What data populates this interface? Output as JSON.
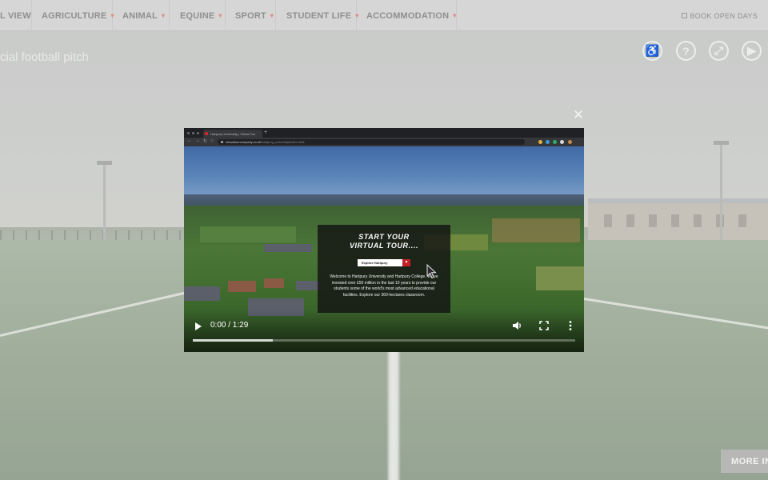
{
  "nav": {
    "items": [
      {
        "label": "L VIEW",
        "caret": ""
      },
      {
        "label": "AGRICULTURE",
        "caret": "▾"
      },
      {
        "label": "ANIMAL",
        "caret": "▾"
      },
      {
        "label": "EQUINE",
        "caret": "▾"
      },
      {
        "label": "SPORT",
        "caret": "▾"
      },
      {
        "label": "STUDENT LIFE",
        "caret": "▾"
      },
      {
        "label": "ACCOMMODATION",
        "caret": "▾"
      }
    ],
    "book_label": "BOOK OPEN DAYS"
  },
  "scene": {
    "title": "cial football pitch"
  },
  "tools": [
    {
      "icon": "accessibility-icon",
      "glyph": "♿"
    },
    {
      "icon": "help-icon",
      "glyph": "?"
    },
    {
      "icon": "fullscreen-icon",
      "glyph": "⤢"
    },
    {
      "icon": "play-circle-icon",
      "glyph": "▶"
    }
  ],
  "more_info_label": "MORE IN",
  "modal": {
    "close_glyph": "✕",
    "browser": {
      "tab_title": "Hartpury University | Virtual Tou",
      "url_host": "virtualtourcompany.co.uk",
      "url_path": "/hartpury_university/index.html"
    },
    "overlay": {
      "headline_1": "START YOUR",
      "headline_2": "VIRTUAL TOUR....",
      "select_value": "Explore Hartpury",
      "intro": "Welcome to Hartpury University and Hartpury College. We've invested over £50 million in the last 10 years to provide our students some of the world's most advanced educational facilities. Explore our 360-hectares classroom."
    },
    "player": {
      "time": "0:00 / 1:29",
      "buffered_fraction": 0.21
    }
  },
  "colors": {
    "nav_bg": "#d5d6d5",
    "nav_text": "#8e8f8f",
    "accent_red": "#c41f25",
    "video_bg": "#1d2026"
  }
}
